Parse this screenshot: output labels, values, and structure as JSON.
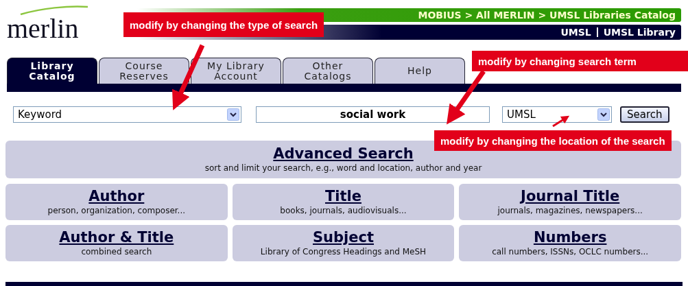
{
  "logo": {
    "text": "merlin"
  },
  "breadcrumb": "MOBIUS > All MERLIN > UMSL Libraries Catalog",
  "location_links": [
    "UMSL",
    "UMSL Library"
  ],
  "tabs": [
    {
      "label": "Library\nCatalog",
      "selected": true
    },
    {
      "label": "Course\nReserves",
      "selected": false
    },
    {
      "label": "My Library\nAccount",
      "selected": false
    },
    {
      "label": "Other\nCatalogs",
      "selected": false
    },
    {
      "label": "Help",
      "selected": false
    }
  ],
  "search": {
    "type": "Keyword",
    "term": "social work",
    "location": "UMSL",
    "button": "Search"
  },
  "advanced": {
    "title": "Advanced Search",
    "description": "sort and limit your search, e.g., word and location, author and year"
  },
  "options": [
    {
      "title": "Author",
      "description": "person, organization, composer..."
    },
    {
      "title": "Title",
      "description": "books, journals, audiovisuals..."
    },
    {
      "title": "Journal Title",
      "description": "journals, magazines, newspapers..."
    },
    {
      "title": "Author & Title",
      "description": "combined search"
    },
    {
      "title": "Subject",
      "description": "Library of Congress Headings and MeSH"
    },
    {
      "title": "Numbers",
      "description": "call numbers, ISSNs, OCLC numbers..."
    }
  ],
  "annotations": [
    "modify by changing the type of search",
    "modify by changing search term",
    "modify by changing the location of the search"
  ]
}
